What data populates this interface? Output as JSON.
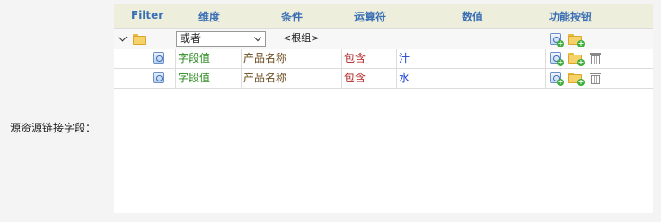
{
  "field_label": "源资源链接字段：",
  "table": {
    "headers": {
      "filter": "Filter",
      "dimension": "维度",
      "condition": "条件",
      "operator": "运算符",
      "value": "数值",
      "actions": "功能按钮"
    },
    "group_row": {
      "logic_select": "或者",
      "group_label": "<根组>"
    },
    "rows": [
      {
        "dimension": "字段值",
        "condition": "产品名称",
        "operator": "包含",
        "value": "汁"
      },
      {
        "dimension": "字段值",
        "condition": "产品名称",
        "operator": "包含",
        "value": "水"
      }
    ]
  },
  "colors": {
    "header_bg": "#eeeedc",
    "header_text": "#3a6fb5",
    "dimension_text": "#2e8b22",
    "condition_text": "#6b4a1e",
    "operator_text": "#b22222",
    "value_text": "#1a3fd0"
  }
}
